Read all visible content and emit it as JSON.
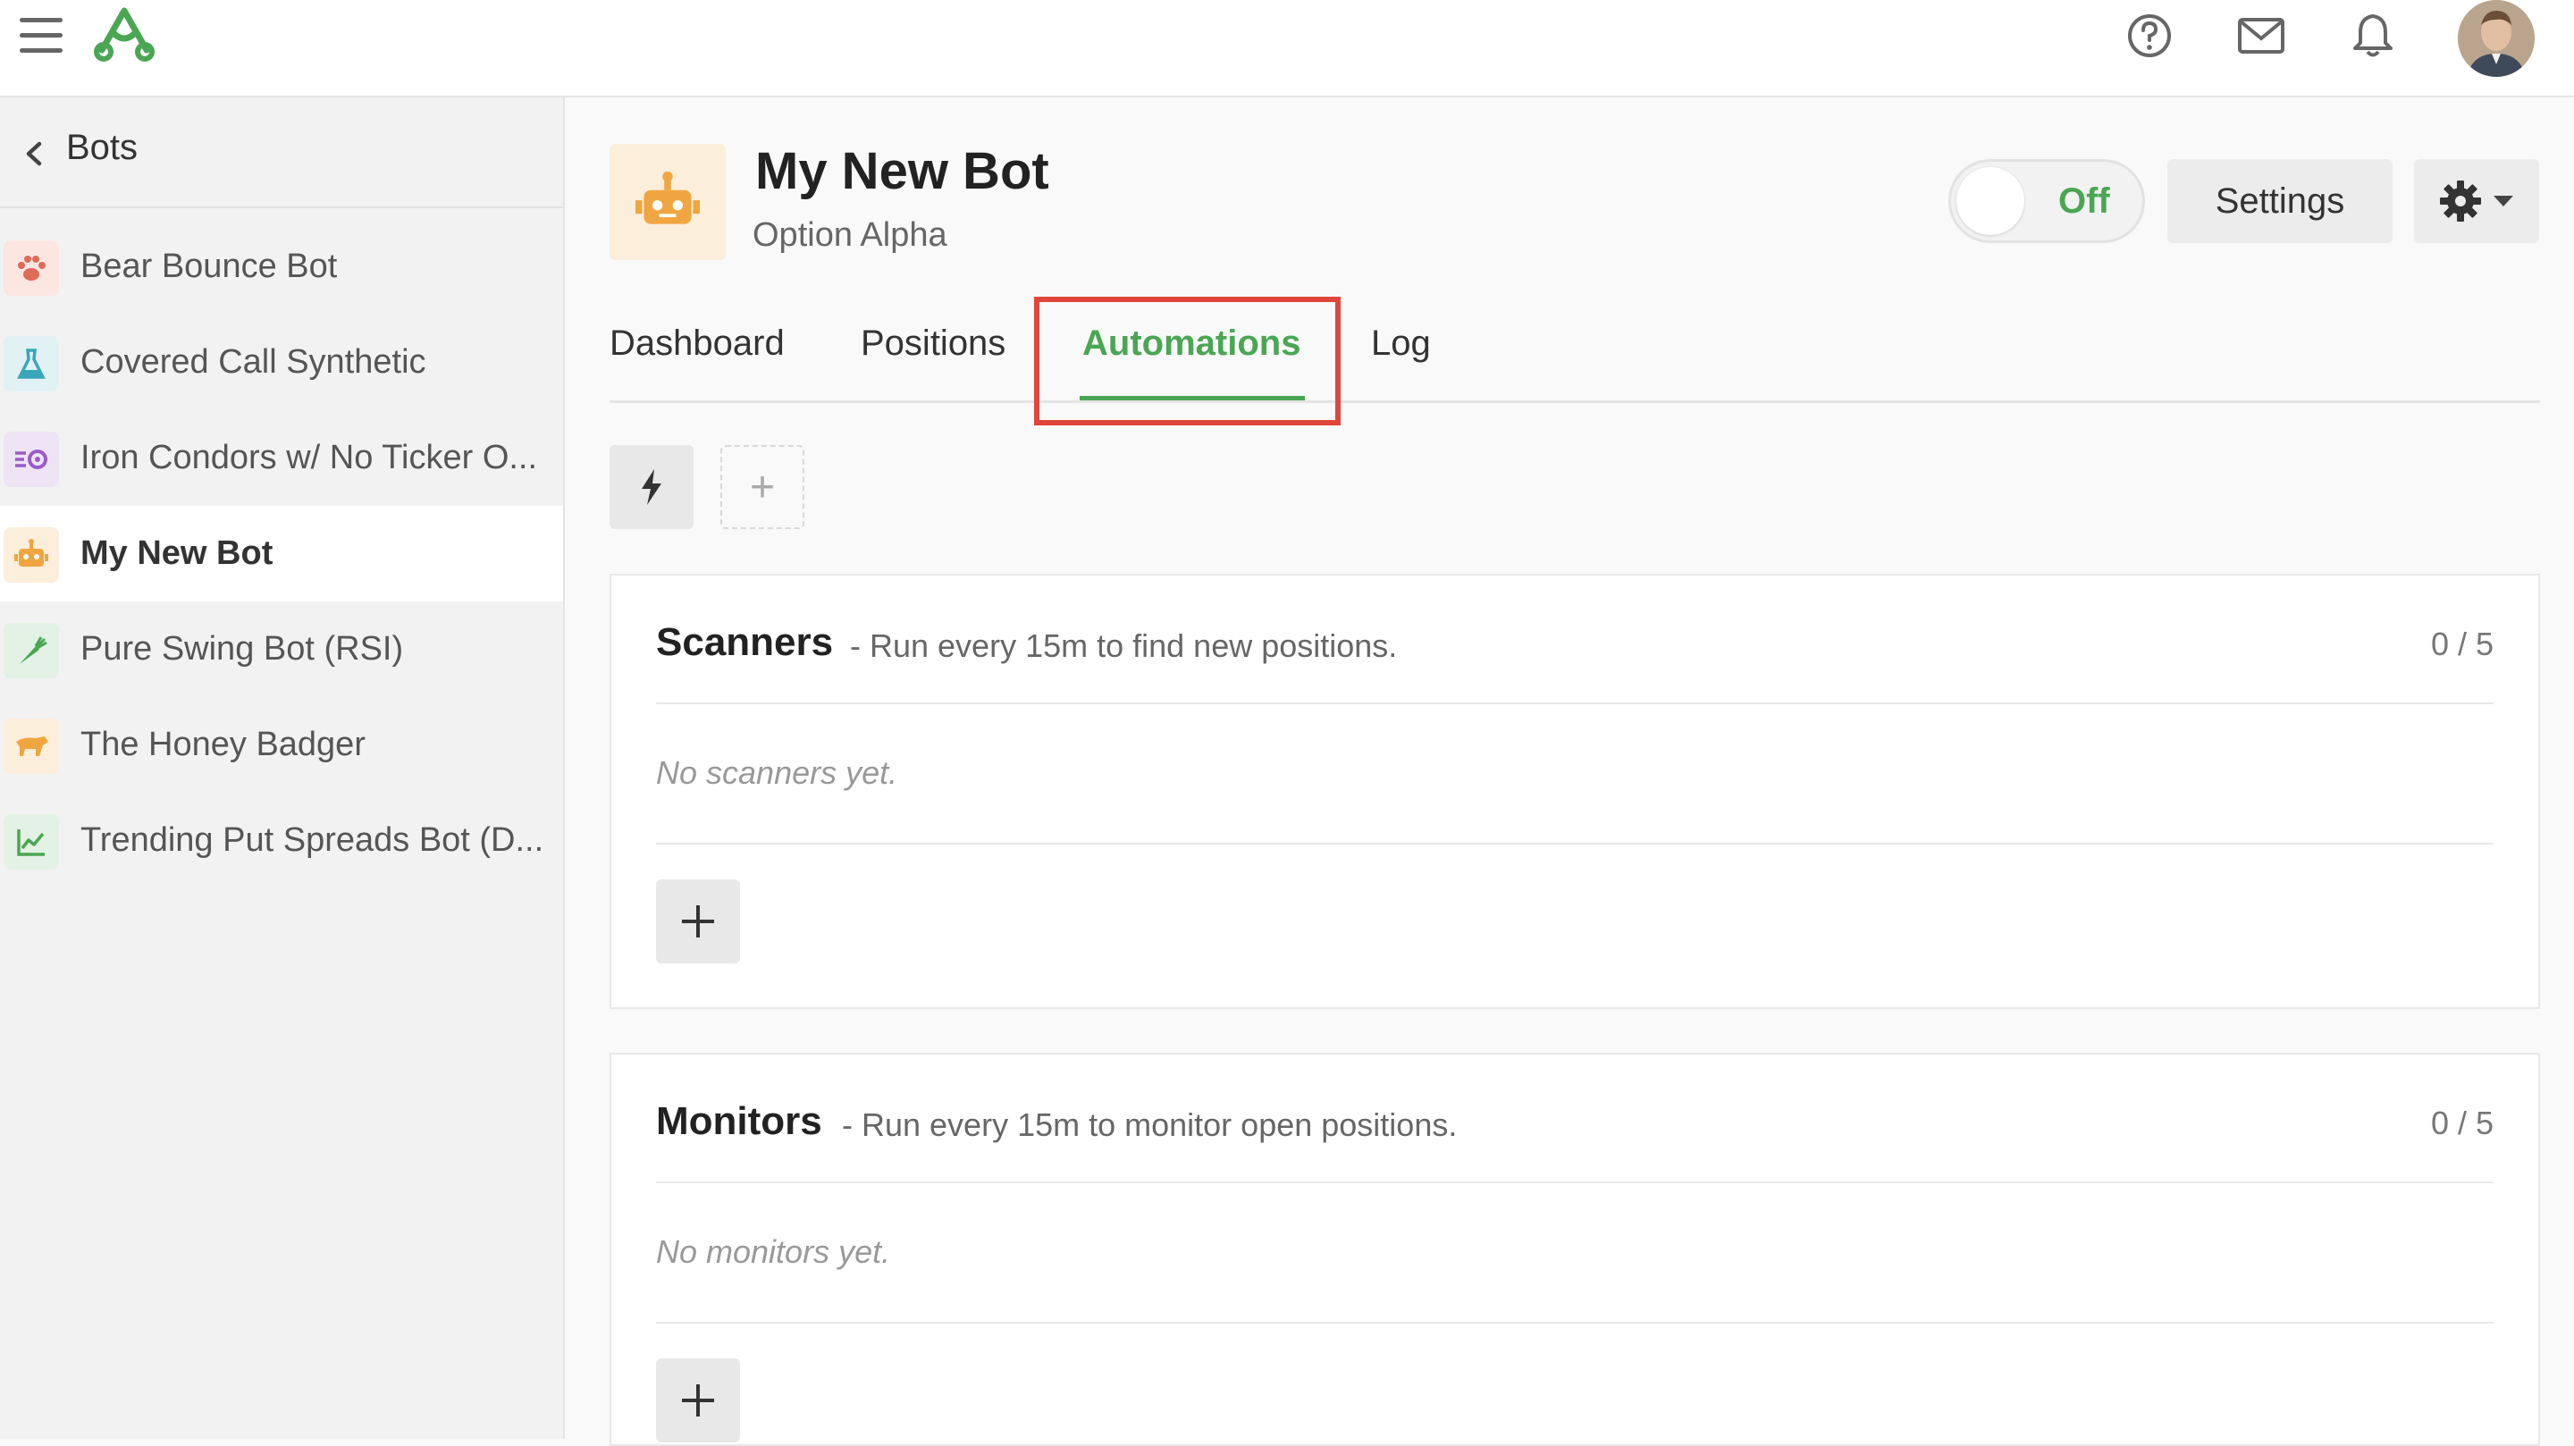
{
  "colors": {
    "accent": "#4aa653",
    "highlight": "#e0453b"
  },
  "topbar": {
    "icons": [
      "menu-icon",
      "logo-icon",
      "help-icon",
      "mail-icon",
      "bell-icon",
      "avatar"
    ]
  },
  "sidebar": {
    "back_label": "Bots",
    "items": [
      {
        "label": "Bear Bounce Bot",
        "icon": "paw-icon",
        "color": "#e06b57"
      },
      {
        "label": "Covered Call Synthetic",
        "icon": "flask-icon",
        "color": "#3aa6b9"
      },
      {
        "label": "Iron Condors w/ No Ticker O...",
        "icon": "condor-icon",
        "color": "#9a5cc6"
      },
      {
        "label": "My New Bot",
        "icon": "robot-icon",
        "color": "#f0a640",
        "active": true
      },
      {
        "label": "Pure Swing Bot (RSI)",
        "icon": "carrot-icon",
        "color": "#4aa653"
      },
      {
        "label": "The Honey Badger",
        "icon": "badger-icon",
        "color": "#f0a640"
      },
      {
        "label": "Trending Put Spreads Bot (D...",
        "icon": "chart-line-icon",
        "color": "#4aa653"
      }
    ]
  },
  "bot": {
    "title": "My New Bot",
    "subtitle": "Option Alpha",
    "toggle_label": "Off",
    "settings_label": "Settings"
  },
  "tabs": [
    {
      "label": "Dashboard"
    },
    {
      "label": "Positions"
    },
    {
      "label": "Automations",
      "active": true
    },
    {
      "label": "Log"
    }
  ],
  "toolbar": {
    "add_symbol": "+"
  },
  "cards": {
    "scanners": {
      "title": "Scanners",
      "description": "- Run every 15m to find new positions.",
      "count": "0 / 5",
      "empty": "No scanners yet."
    },
    "monitors": {
      "title": "Monitors",
      "description": "- Run every 15m to monitor open positions.",
      "count": "0 / 5",
      "empty": "No monitors yet."
    }
  }
}
